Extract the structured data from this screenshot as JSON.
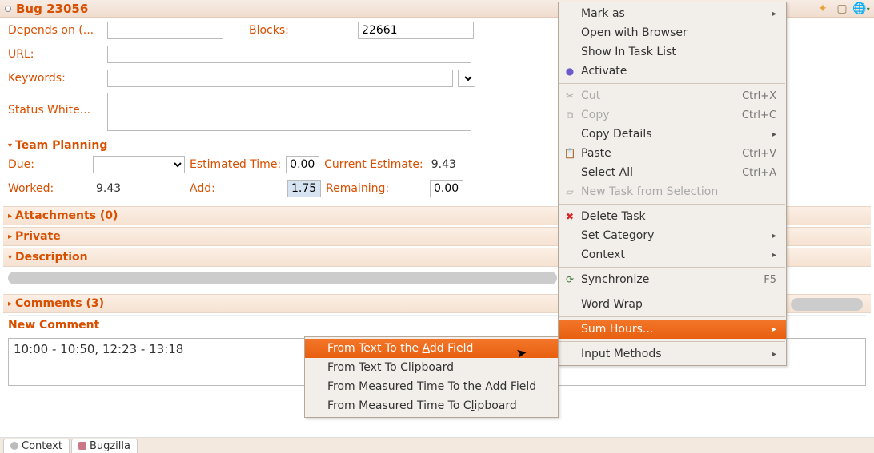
{
  "title": "Bug 23056",
  "fields": {
    "depends_on_label": "Depends on (...",
    "blocks_label": "Blocks:",
    "blocks_value": "22661",
    "url_label": "URL:",
    "keywords_label": "Keywords:",
    "status_white_label": "Status White..."
  },
  "team_planning": {
    "header": "Team Planning",
    "due_label": "Due:",
    "estimated_label": "Estimated Time:",
    "estimated_value": "0.00",
    "current_est_label": "Current Estimate:",
    "current_est_value": "9.43",
    "worked_label": "Worked:",
    "worked_value": "9.43",
    "add_label": "Add:",
    "add_value": "1.75",
    "remaining_label": "Remaining:",
    "remaining_value": "0.00"
  },
  "sections": {
    "attachments": "Attachments (0)",
    "private": "Private",
    "description": "Description",
    "comments": "Comments (3)",
    "new_comment": "New Comment"
  },
  "comment_text": "10:00 - 10:50, 12:23 - 13:18",
  "tabs": {
    "context": "Context",
    "bugzilla": "Bugzilla"
  },
  "main_menu": {
    "mark_as": "Mark as",
    "open_browser": "Open with Browser",
    "show_task_list": "Show In Task List",
    "activate": "Activate",
    "cut": "Cut",
    "cut_key": "Ctrl+X",
    "copy": "Copy",
    "copy_key": "Ctrl+C",
    "copy_details": "Copy Details",
    "paste": "Paste",
    "paste_key": "Ctrl+V",
    "select_all": "Select All",
    "select_all_key": "Ctrl+A",
    "new_task": "New Task from Selection",
    "delete_task": "Delete Task",
    "set_category": "Set Category",
    "context": "Context",
    "synchronize": "Synchronize",
    "sync_key": "F5",
    "word_wrap": "Word Wrap",
    "sum_hours": "Sum Hours...",
    "input_methods": "Input Methods"
  },
  "sub_menu": {
    "from_text_add": "From Text To the Add Field",
    "from_text_clip": "From Text To Clipboard",
    "from_measured_add": "From Measured Time To the Add Field",
    "from_measured_clip": "From Measured Time To Clipboard"
  }
}
